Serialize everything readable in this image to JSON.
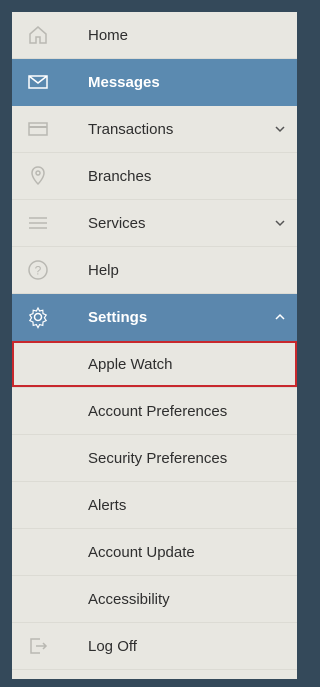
{
  "menu": {
    "items": [
      {
        "label": "Home",
        "icon": "home-icon"
      },
      {
        "label": "Messages",
        "icon": "envelope-icon",
        "active": true
      },
      {
        "label": "Transactions",
        "icon": "card-icon",
        "chevron": "down"
      },
      {
        "label": "Branches",
        "icon": "location-pin-icon"
      },
      {
        "label": "Services",
        "icon": "menu-lines-icon",
        "chevron": "down"
      },
      {
        "label": "Help",
        "icon": "question-icon"
      },
      {
        "label": "Settings",
        "icon": "gear-icon",
        "active": true,
        "chevron": "up"
      }
    ],
    "settings_sub": [
      {
        "label": "Apple Watch",
        "selected": true
      },
      {
        "label": "Account Preferences"
      },
      {
        "label": "Security Preferences"
      },
      {
        "label": "Alerts"
      },
      {
        "label": "Account Update"
      },
      {
        "label": "Accessibility"
      }
    ],
    "logoff": {
      "label": "Log Off",
      "icon": "logout-icon"
    }
  },
  "colors": {
    "active_bg": "#5b8ab0",
    "background": "#e8e7e1",
    "frame": "#34495a",
    "selected_outline": "#c8282d"
  }
}
